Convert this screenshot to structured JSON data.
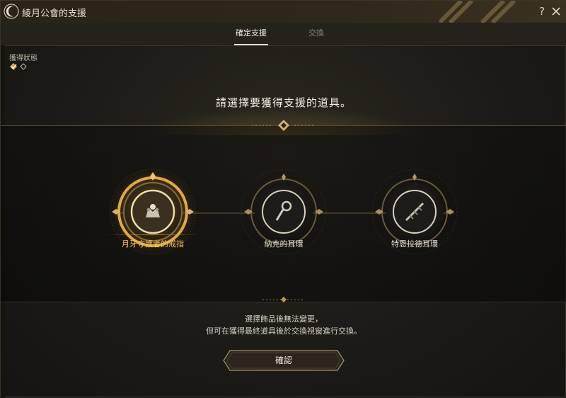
{
  "window": {
    "title": "綾月公會的支援",
    "help_icon": "question-icon",
    "close_icon": "close-icon"
  },
  "tabs": [
    {
      "label": "確定支援",
      "active": true
    },
    {
      "label": "交換",
      "active": false
    }
  ],
  "status": {
    "label": "獲得狀態",
    "icons": [
      "check-diamond-icon",
      "empty-diamond-icon"
    ]
  },
  "prompt": "請選擇要獲得支援的道具。",
  "items": [
    {
      "name": "月牙守護者的戒指",
      "icon": "ring-icon",
      "selected": true
    },
    {
      "name": "納克的耳環",
      "icon": "earring-icon",
      "selected": false
    },
    {
      "name": "特恩拉德耳環",
      "icon": "feather-earring-icon",
      "selected": false
    }
  ],
  "notes": [
    "選擇飾品後無法變更，",
    "但可在獲得最終道具後於交換視窗進行交換。"
  ],
  "confirm_label": "確認",
  "colors": {
    "accent_gold": "#f3c15a",
    "background": "#1d1b17",
    "text": "#e6e0d2"
  }
}
